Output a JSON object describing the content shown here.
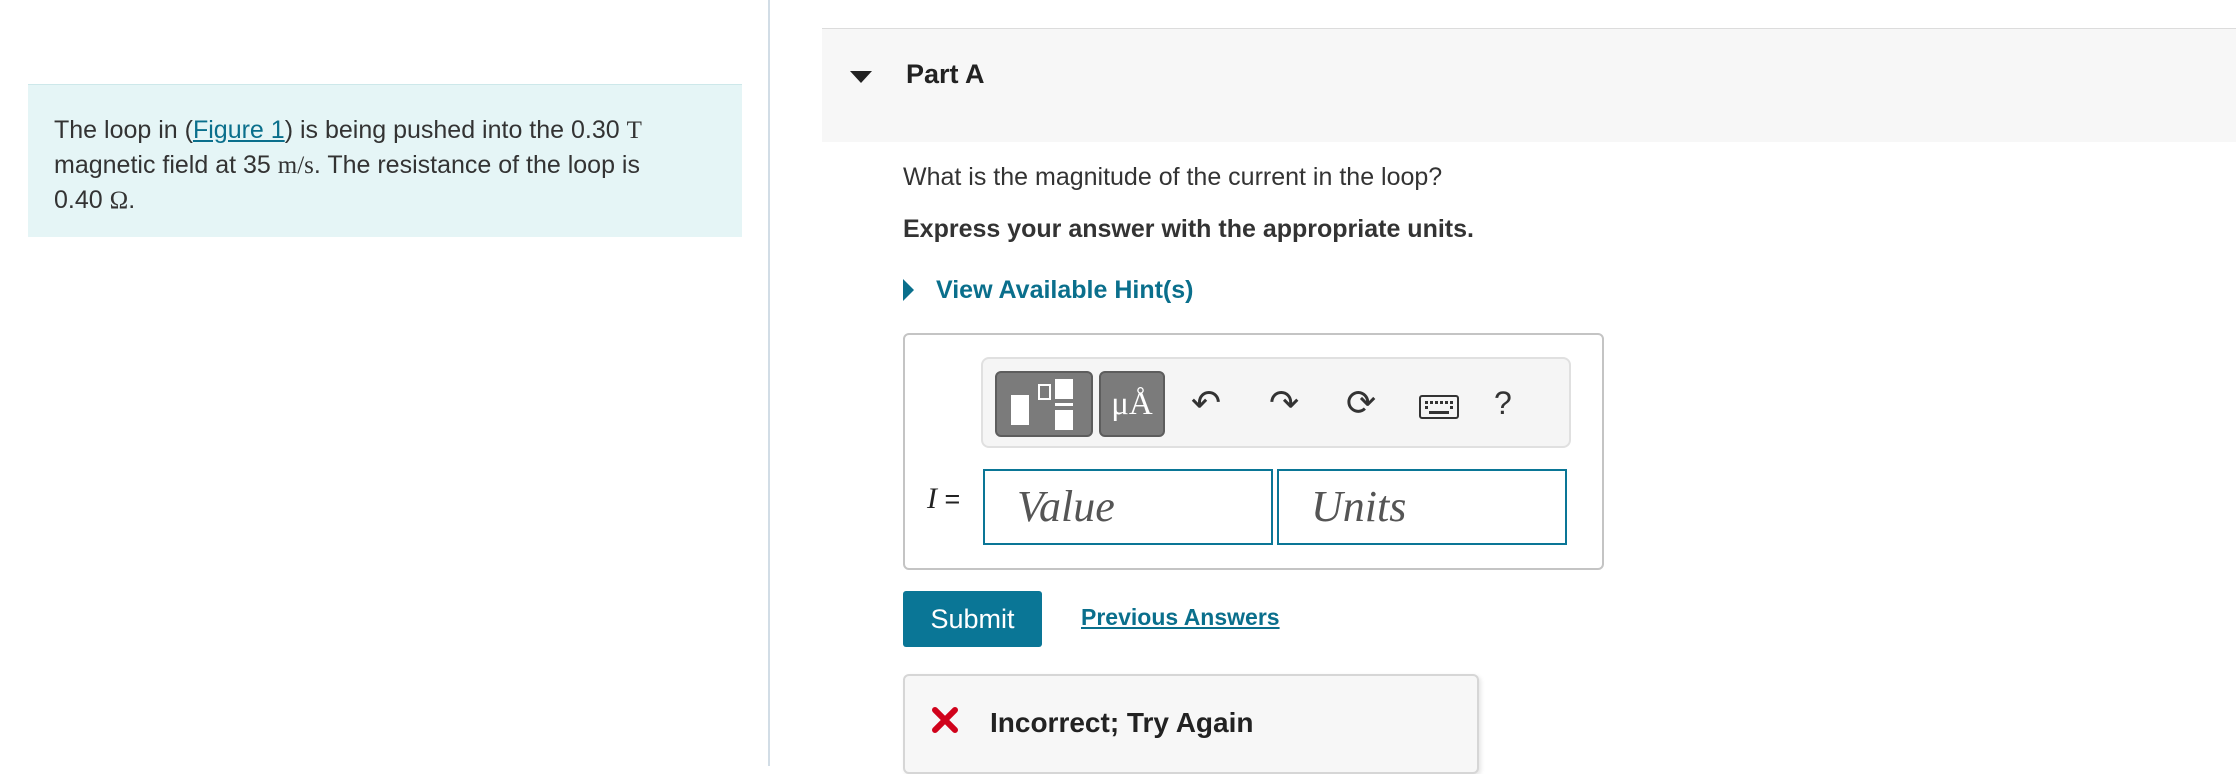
{
  "problem": {
    "intro": "The loop in (",
    "figure_link": "Figure 1",
    "text_after_link": ") is being pushed into the 0.30 ",
    "field_unit": "T",
    "line2_a": "magnetic field at 35 ",
    "speed_unit": "m/s",
    "line2_b": ". The resistance of the loop is",
    "resistance_value": "0.40 ",
    "resistance_unit": "Ω",
    "period": "."
  },
  "part": {
    "title": "Part A"
  },
  "question": "What is the magnitude of the current in the loop?",
  "instruction": "Express your answer with the appropriate units.",
  "hints": {
    "label": "View Available Hint(s)"
  },
  "toolbar": {
    "units_symbol": "μÅ",
    "undo_icon": "↶",
    "redo_icon": "↷",
    "reset_icon": "⟳",
    "help_label": "?"
  },
  "answer": {
    "variable": "I",
    "equals": "=",
    "value_placeholder": "Value",
    "units_placeholder": "Units"
  },
  "actions": {
    "submit_label": "Submit",
    "previous_answers_label": "Previous Answers"
  },
  "feedback": {
    "text": "Incorrect; Try Again",
    "error_color": "#d0021b"
  },
  "colors": {
    "accent": "#0a7696",
    "problem_bg": "#e5f5f6"
  }
}
